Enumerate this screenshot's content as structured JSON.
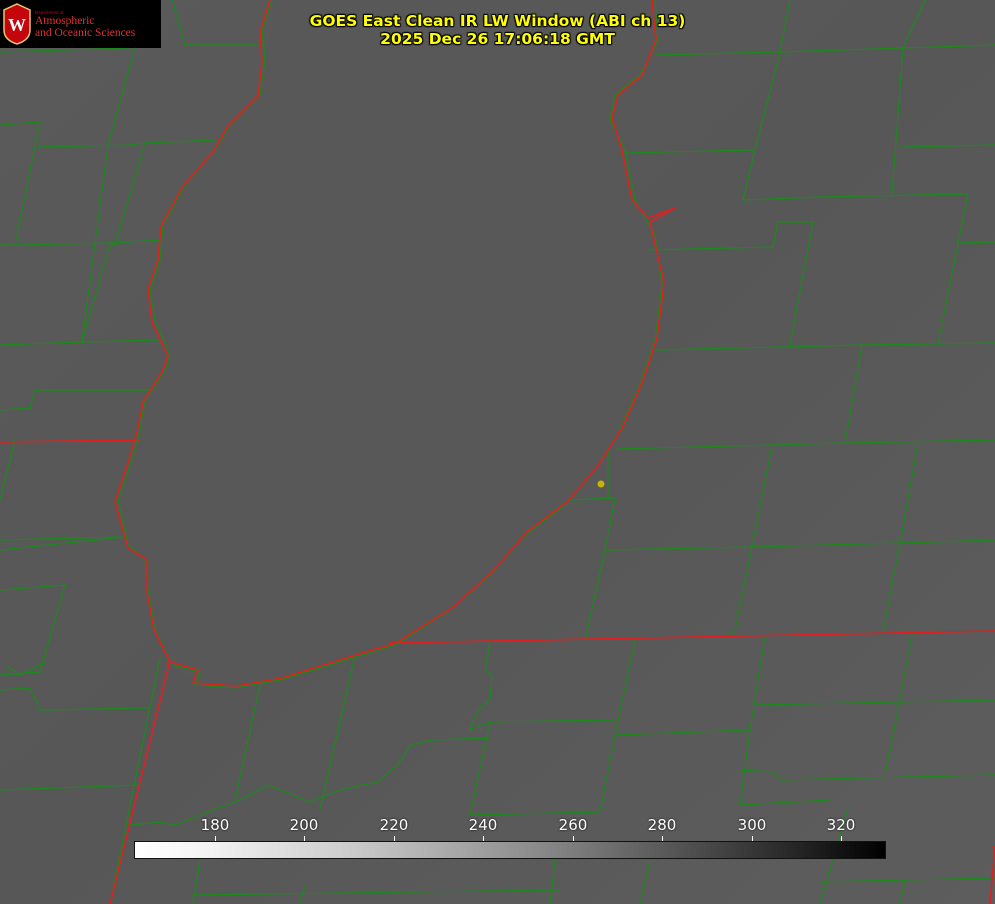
{
  "title": {
    "line1": "GOES East Clean IR LW Window (ABI ch 13)",
    "line2": "2025 Dec 26 17:06:18 GMT"
  },
  "logo": {
    "department": "Department of",
    "name_line1": "Atmospheric",
    "name_line2": "and Oceanic Sciences",
    "seal_letter": "W"
  },
  "colorbar": {
    "ticks": [
      "180",
      "200",
      "220",
      "240",
      "260",
      "280",
      "300",
      "320"
    ],
    "gradient": "white-to-black"
  },
  "colors": {
    "county_lines": "#1a8a1a",
    "state_lines": "#e02020",
    "title_text": "#ffff00",
    "marker": "#c8b400"
  }
}
